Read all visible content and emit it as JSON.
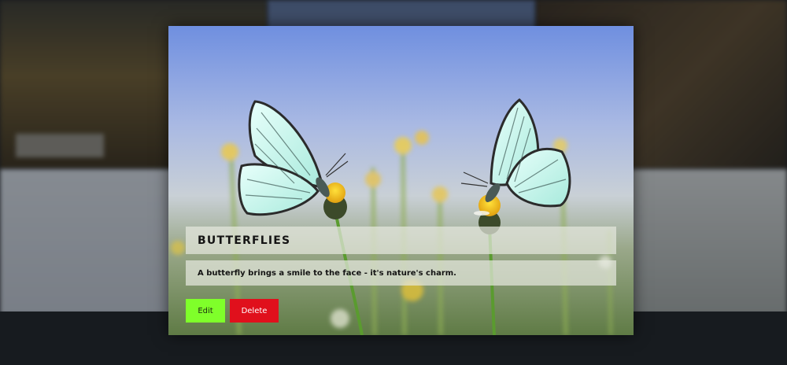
{
  "card": {
    "title": "BUTTERFLIES",
    "description": "A butterfly brings a smile to the face - it's nature's charm.",
    "image_subject": "butterflies-photo"
  },
  "actions": {
    "edit_label": "Edit",
    "delete_label": "Delete"
  },
  "colors": {
    "edit_button": "#7fff2a",
    "delete_button": "#e0101c",
    "caption_panel": "#e4e8de",
    "overlay_background": "#1e2227"
  }
}
